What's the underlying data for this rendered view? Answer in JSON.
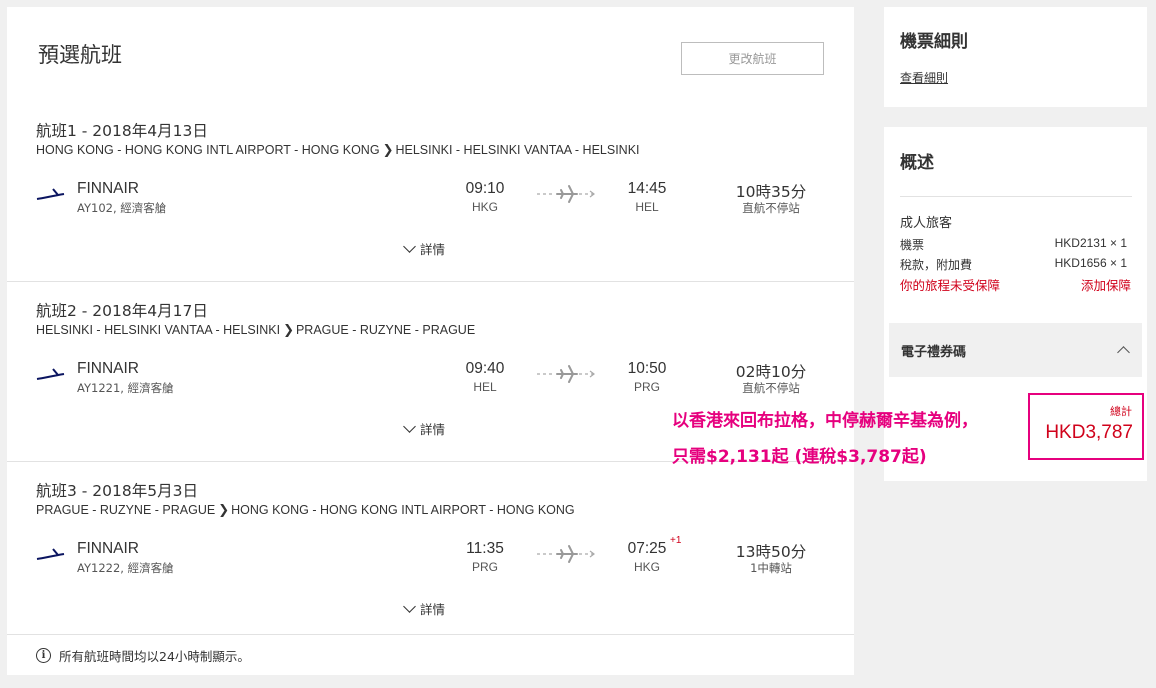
{
  "page_title": "預選航班",
  "change_button": "更改航班",
  "details_label": "詳情",
  "airline": {
    "name": "FINNAIR",
    "logo_icon": "finnair-logo-icon",
    "brand_color": "#0b1560"
  },
  "segments": [
    {
      "title": "航班1 - 2018年4月13日",
      "origin": "HONG KONG - HONG KONG INTL AIRPORT - HONG KONG",
      "destination": "HELSINKI - HELSINKI VANTAA - HELSINKI",
      "flight_info": "AY102, 經濟客艙",
      "dep_time": "09:10",
      "dep_code": "HKG",
      "arr_time": "14:45",
      "arr_code": "HEL",
      "arr_day_offset": "",
      "duration": "10時35分",
      "stops": "直航不停站"
    },
    {
      "title": "航班2 - 2018年4月17日",
      "origin": "HELSINKI - HELSINKI VANTAA - HELSINKI",
      "destination": "PRAGUE - RUZYNE - PRAGUE",
      "flight_info": "AY1221, 經濟客艙",
      "dep_time": "09:40",
      "dep_code": "HEL",
      "arr_time": "10:50",
      "arr_code": "PRG",
      "arr_day_offset": "",
      "duration": "02時10分",
      "stops": "直航不停站"
    },
    {
      "title": "航班3 - 2018年5月3日",
      "origin": "PRAGUE - RUZYNE - PRAGUE",
      "destination": "HONG KONG - HONG KONG INTL AIRPORT - HONG KONG",
      "flight_info": "AY1222, 經濟客艙",
      "dep_time": "11:35",
      "dep_code": "PRG",
      "arr_time": "07:25",
      "arr_code": "HKG",
      "arr_day_offset": "+1",
      "duration": "13時50分",
      "stops": "1中轉站"
    }
  ],
  "footer_note": "所有航班時間均以24小時制顯示。",
  "rules": {
    "title": "機票細則",
    "link": "查看細則"
  },
  "summary": {
    "title": "概述",
    "passenger_type": "成人旅客",
    "rows": [
      {
        "label": "機票",
        "value": "HKD2131 × 1"
      },
      {
        "label": "稅款，附加費",
        "value": "HKD1656 × 1"
      }
    ],
    "insurance_warning": "你的旅程未受保障",
    "insurance_link": "添加保障",
    "voucher_label": "電子禮券碼",
    "total_label": "總計",
    "total_value": "HKD3,787"
  },
  "promo": {
    "line1": "以香港來回布拉格，中停赫爾辛基為例，",
    "line2": "只需$2,131起 (連稅$3,787起)"
  },
  "colors": {
    "accent": "#e6007e",
    "warning": "#d0021b"
  }
}
